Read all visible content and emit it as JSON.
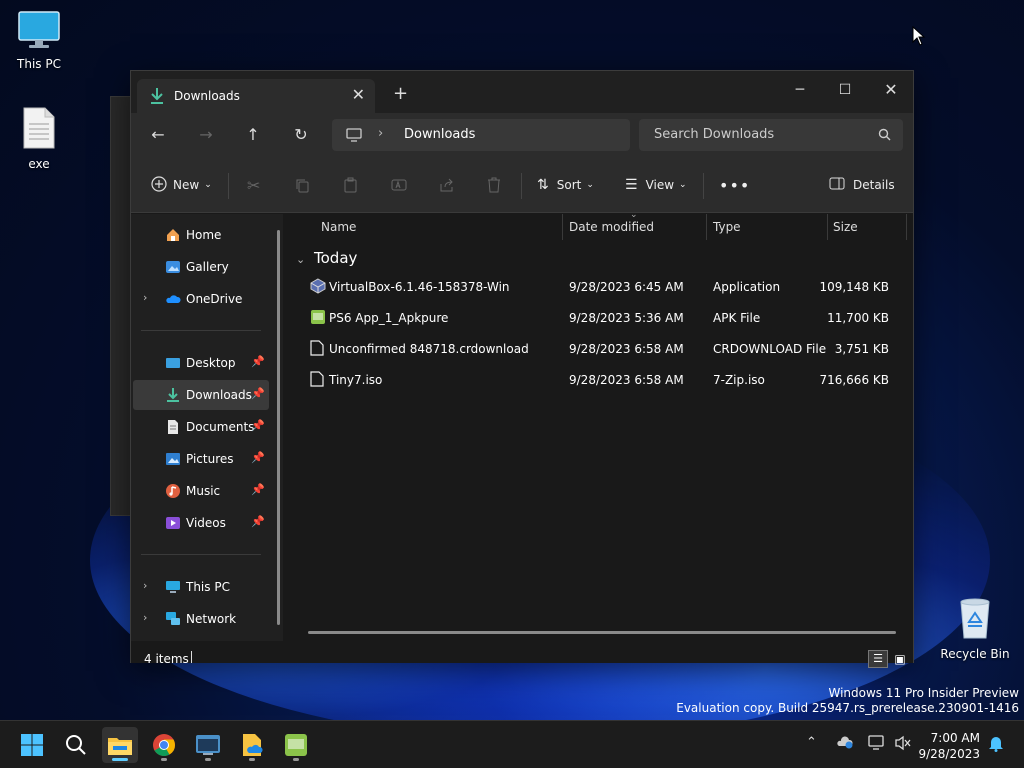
{
  "desktop": {
    "icons": [
      {
        "label": "This PC"
      },
      {
        "label": "exe"
      },
      {
        "label": "Recycle Bin"
      }
    ],
    "watermark": {
      "line1": "Windows 11 Pro Insider Preview",
      "line2": "Evaluation copy. Build 25947.rs_prerelease.230901-1416"
    }
  },
  "window": {
    "tab_title": "Downloads",
    "address": {
      "crumb": "Downloads"
    },
    "search": {
      "placeholder": "Search Downloads"
    },
    "commands": {
      "new_label": "New",
      "sort_label": "Sort",
      "view_label": "View",
      "details_label": "Details"
    },
    "nav": {
      "items": [
        {
          "label": "Home"
        },
        {
          "label": "Gallery"
        },
        {
          "label": "OneDrive"
        },
        {
          "label": "Desktop"
        },
        {
          "label": "Downloads"
        },
        {
          "label": "Documents"
        },
        {
          "label": "Pictures"
        },
        {
          "label": "Music"
        },
        {
          "label": "Videos"
        },
        {
          "label": "This PC"
        },
        {
          "label": "Network"
        }
      ]
    },
    "columns": {
      "name": "Name",
      "date": "Date modified",
      "type": "Type",
      "size": "Size"
    },
    "group": "Today",
    "files": [
      {
        "name": "VirtualBox-6.1.46-158378-Win",
        "date": "9/28/2023 6:45 AM",
        "type": "Application",
        "size": "109,148 KB",
        "icon": "virtualbox-icon"
      },
      {
        "name": "PS6 App_1_Apkpure",
        "date": "9/28/2023 5:36 AM",
        "type": "APK File",
        "size": "11,700 KB",
        "icon": "apk-icon"
      },
      {
        "name": "Unconfirmed 848718.crdownload",
        "date": "9/28/2023 6:58 AM",
        "type": "CRDOWNLOAD File",
        "size": "3,751 KB",
        "icon": "file-icon"
      },
      {
        "name": "Tiny7.iso",
        "date": "9/28/2023 6:58 AM",
        "type": "7-Zip.iso",
        "size": "716,666 KB",
        "icon": "file-icon"
      }
    ],
    "status": {
      "count": "4 items"
    }
  },
  "taskbar": {
    "clock": {
      "time": "7:00 AM",
      "date": "9/28/2023"
    }
  },
  "colors": {
    "accent": "#60cdff",
    "window_bg": "#191919",
    "toolbar_bg": "#2c2c2c"
  }
}
